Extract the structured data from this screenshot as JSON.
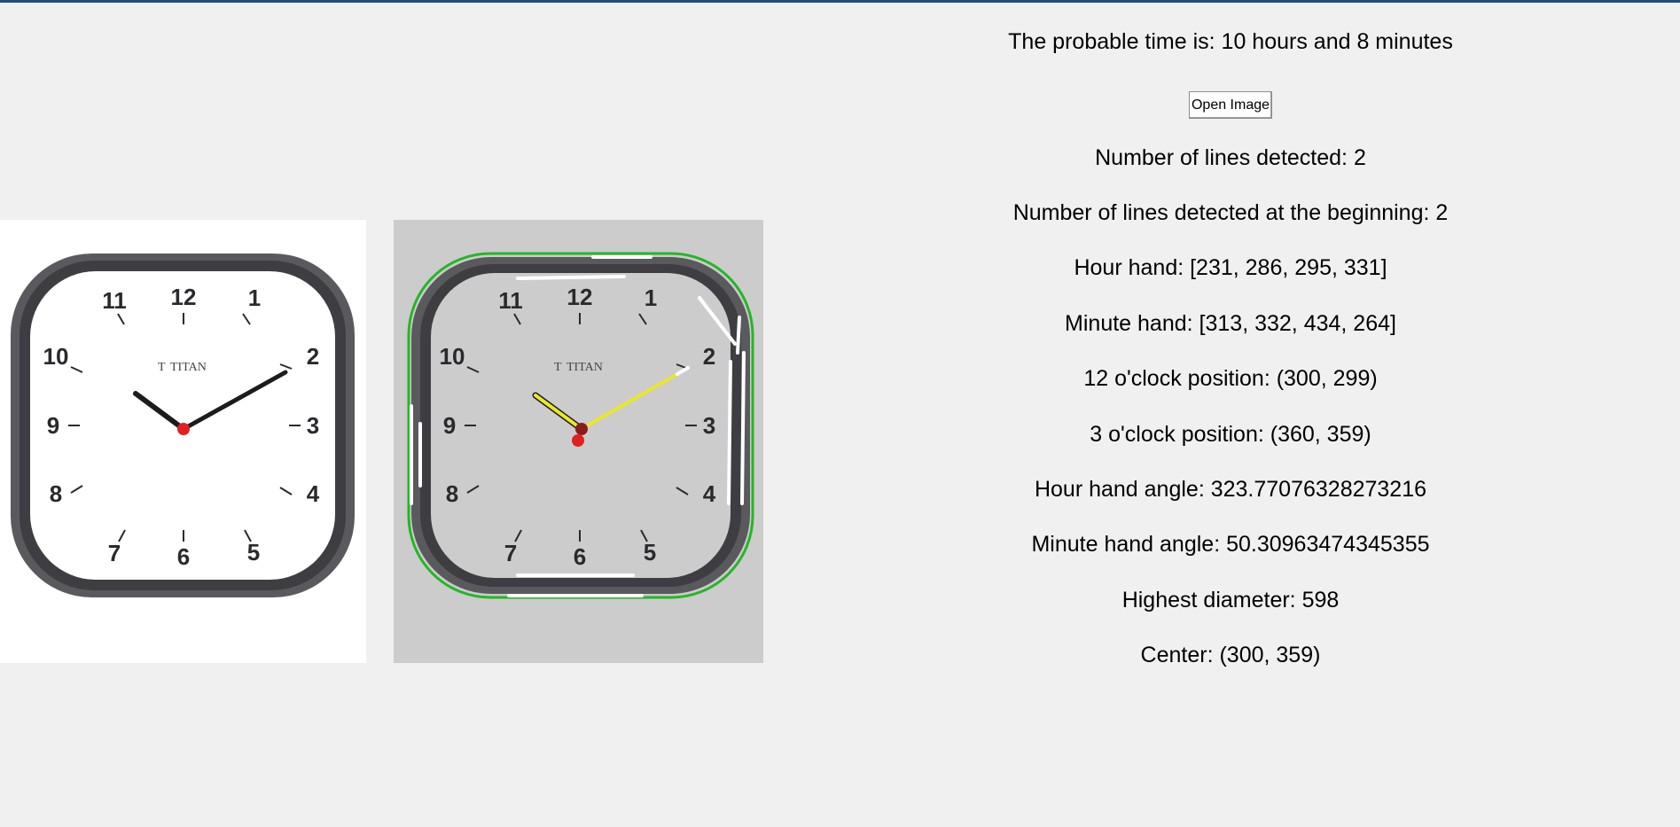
{
  "result": {
    "time_text": "The probable time is: 10 hours and 8 minutes"
  },
  "toolbar": {
    "open_image_label": "Open Image"
  },
  "details": {
    "lines_detected": "Number of lines detected: 2",
    "lines_detected_beginning": "Number of lines detected at the beginning: 2",
    "hour_hand": "Hour hand: [231, 286, 295, 331]",
    "minute_hand": "Minute hand: [313, 332, 434, 264]",
    "twelve_position": "12 o'clock position: (300, 299)",
    "three_position": "3 o'clock position: (360, 359)",
    "hour_angle": "Hour hand angle: 323.77076328273216",
    "minute_angle": "Minute hand angle: 50.30963474345355",
    "highest_diameter": "Highest diameter: 598",
    "center": "Center: (300, 359)"
  },
  "clock": {
    "brand": "TITAN",
    "brand_mark": "T",
    "numerals": [
      "12",
      "1",
      "2",
      "3",
      "4",
      "5",
      "6",
      "7",
      "8",
      "9",
      "10",
      "11"
    ]
  },
  "colors": {
    "hand_highlight": "#e8e82a",
    "outline": "#22b822",
    "center_dot": "#e02020",
    "window_accent": "#1f4e79"
  }
}
